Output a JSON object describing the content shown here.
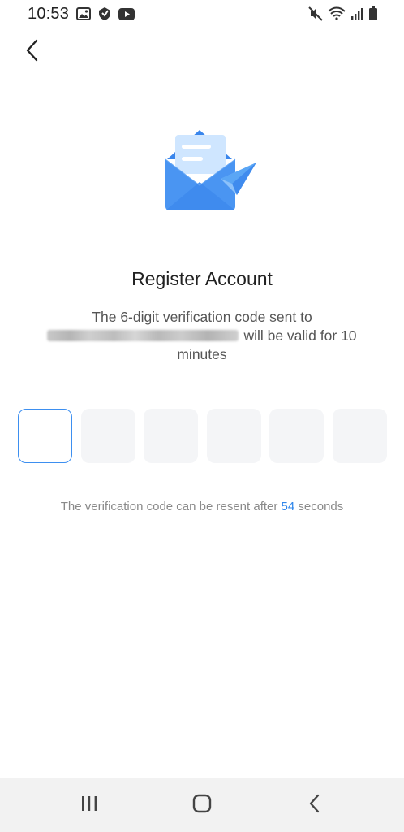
{
  "status_bar": {
    "time": "10:53",
    "left_icons": [
      "gallery-icon",
      "location-app-icon",
      "youtube-icon"
    ],
    "right_icons": [
      "mute-icon",
      "wifi-icon",
      "signal-icon",
      "battery-icon"
    ]
  },
  "header": {
    "back_icon": "chevron-left-icon"
  },
  "illustration": {
    "name": "envelope-with-paper-plane",
    "colors": {
      "envelope": "#3d8ff0",
      "letter": "#bfe0ff",
      "plane": "#5aa6f5"
    }
  },
  "main": {
    "title": "Register Account",
    "description_prefix": "The 6-digit verification code sent to",
    "email_masked": "",
    "description_suffix": "will be valid for 10 minutes",
    "code_boxes": [
      "",
      "",
      "",
      "",
      "",
      ""
    ],
    "active_box_index": 0,
    "resend_prefix": "The verification code can be resent after",
    "resend_seconds": "54",
    "resend_suffix": "seconds"
  },
  "colors": {
    "accent": "#2f86eb",
    "active_border": "#3d8ff0",
    "box_bg": "#f4f5f7",
    "nav_bg": "#f2f2f2"
  },
  "nav_bar": {
    "icons": [
      "recent-apps-icon",
      "home-icon",
      "back-nav-icon"
    ]
  }
}
